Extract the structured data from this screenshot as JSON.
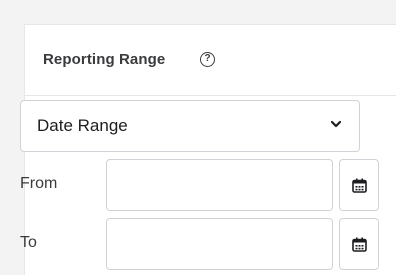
{
  "section": {
    "title": "Reporting Range",
    "help_icon": "question-circle-icon",
    "help_glyph": "?"
  },
  "range_select": {
    "selected": "Date Range",
    "icon": "chevron-down-icon"
  },
  "from_row": {
    "label": "From",
    "value": "",
    "calendar_icon": "calendar-icon"
  },
  "to_row": {
    "label": "To",
    "value": "",
    "calendar_icon": "calendar-icon"
  },
  "colors": {
    "page_bg": "#f3f3f4",
    "panel_bg": "#ffffff",
    "border": "#cfd2d6",
    "text": "#3a3b3d"
  }
}
